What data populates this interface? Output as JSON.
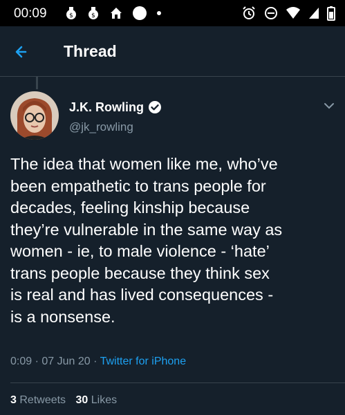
{
  "status_bar": {
    "time": "00:09",
    "left_icons": [
      "money-bag-icon",
      "money-bag-icon",
      "home-icon",
      "circle-icon",
      "dot-icon"
    ],
    "right_icons": [
      "alarm-icon",
      "do-not-disturb-icon",
      "wifi-icon",
      "signal-icon",
      "battery-icon"
    ]
  },
  "header": {
    "title": "Thread",
    "back_icon": "arrow-left-icon",
    "accent": "#1da1f2"
  },
  "tweet": {
    "author_name": "J.K. Rowling",
    "author_handle": "@jk_rowling",
    "verified": true,
    "text": "The idea that women like me, who’ve\nbeen empathetic to trans people for\ndecades, feeling kinship because\nthey’re vulnerable in the same way as\nwomen - ie, to male violence - ‘hate’\ntrans people because they think sex\nis real and has lived consequences -\nis a nonsense.",
    "time": "0:09",
    "separator": "·",
    "date": "07 Jun 20",
    "source": "Twitter for iPhone",
    "retweets_count": "3",
    "retweets_label": "Retweets",
    "likes_count": "30",
    "likes_label": "Likes"
  },
  "colors": {
    "background": "#15202b",
    "status_bar": "#000000",
    "secondary_text": "#8899a6",
    "divider": "#38444d"
  }
}
